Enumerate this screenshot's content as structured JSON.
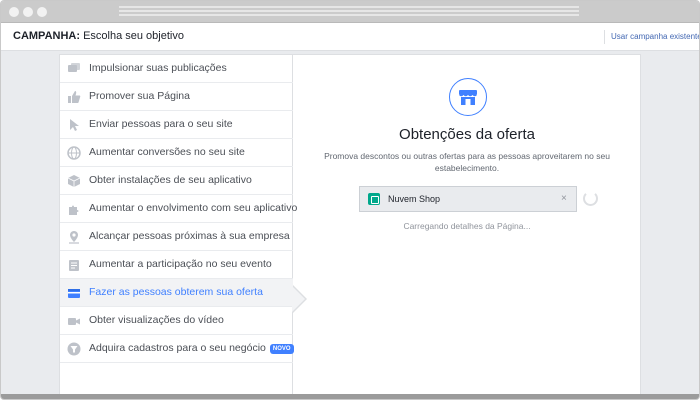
{
  "header": {
    "title_bold": "CAMPANHA:",
    "title_rest": " Escolha seu objetivo",
    "existing_link": "Usar campanha existente"
  },
  "sidebar": {
    "items": [
      {
        "label": "Impulsionar suas publicações",
        "icon": "boost-post-icon"
      },
      {
        "label": "Promover sua Página",
        "icon": "thumbs-up-icon"
      },
      {
        "label": "Enviar pessoas para o seu site",
        "icon": "cursor-icon"
      },
      {
        "label": "Aumentar conversões no seu site",
        "icon": "globe-icon"
      },
      {
        "label": "Obter instalações de seu aplicativo",
        "icon": "box-icon"
      },
      {
        "label": "Aumentar o envolvimento com seu aplicativo",
        "icon": "puzzle-icon"
      },
      {
        "label": "Alcançar pessoas próximas à sua empresa",
        "icon": "map-pin-icon"
      },
      {
        "label": "Aumentar a participação no seu evento",
        "icon": "event-icon"
      },
      {
        "label": "Fazer as pessoas obterem sua oferta",
        "icon": "offer-icon",
        "active": true
      },
      {
        "label": "Obter visualizações do vídeo",
        "icon": "video-camera-icon"
      },
      {
        "label": "Adquira cadastros para o seu negócio",
        "icon": "funnel-icon",
        "badge": "NOVO"
      }
    ]
  },
  "content": {
    "heading": "Obtenções da oferta",
    "description": "Promova descontos ou outras ofertas para as pessoas aproveitarem no seu estabelecimento.",
    "page_name": "Nuvem Shop",
    "close_symbol": "×",
    "loading_text": "Carregando detalhes da Página..."
  },
  "colors": {
    "accent": "#4080ff",
    "icon_gray": "#bec2c9",
    "page_icon": "#00a88c"
  }
}
